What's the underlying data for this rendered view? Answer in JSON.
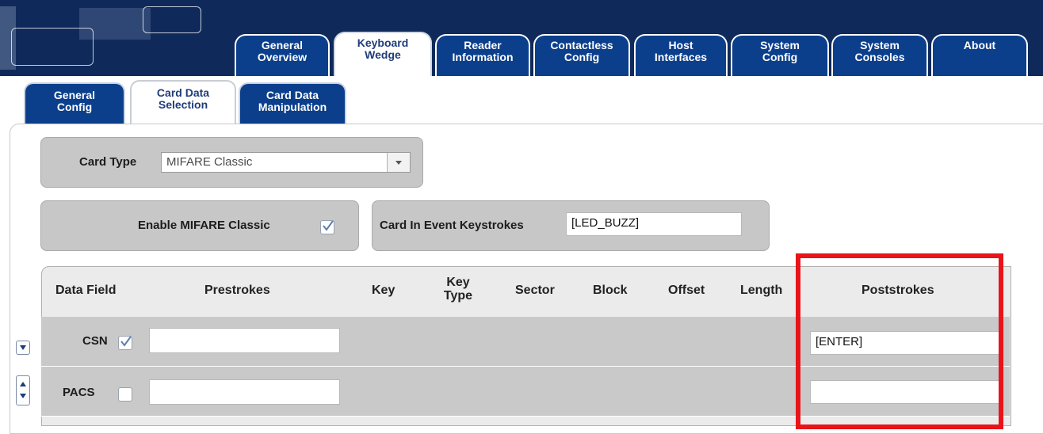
{
  "top_tabs": [
    {
      "label_line1": "General",
      "label_line2": "Overview",
      "active": false
    },
    {
      "label_line1": "Keyboard",
      "label_line2": "Wedge",
      "active": true
    },
    {
      "label_line1": "Reader",
      "label_line2": "Information",
      "active": false
    },
    {
      "label_line1": "Contactless",
      "label_line2": "Config",
      "active": false
    },
    {
      "label_line1": "Host",
      "label_line2": "Interfaces",
      "active": false
    },
    {
      "label_line1": "System",
      "label_line2": "Config",
      "active": false
    },
    {
      "label_line1": "System",
      "label_line2": "Consoles",
      "active": false
    },
    {
      "label_line1": "About",
      "label_line2": "",
      "active": false
    }
  ],
  "sub_tabs": [
    {
      "label_line1": "General",
      "label_line2": "Config",
      "active": false
    },
    {
      "label_line1": "Card Data",
      "label_line2": "Selection",
      "active": true
    },
    {
      "label_line1": "Card Data",
      "label_line2": "Manipulation",
      "active": false
    }
  ],
  "card_type": {
    "label": "Card Type",
    "value": "MIFARE Classic"
  },
  "enable": {
    "label": "Enable MIFARE Classic",
    "checked": true
  },
  "card_in_event": {
    "label": "Card In Event Keystrokes",
    "value": "[LED_BUZZ]"
  },
  "table": {
    "headers": {
      "data_field": "Data Field",
      "prestrokes": "Prestrokes",
      "key": "Key",
      "key_type_line1": "Key",
      "key_type_line2": "Type",
      "sector": "Sector",
      "block": "Block",
      "offset": "Offset",
      "length": "Length",
      "poststrokes": "Poststrokes"
    },
    "rows": [
      {
        "field": "CSN",
        "checked": true,
        "prestrokes": "",
        "poststrokes": "[ENTER]"
      },
      {
        "field": "PACS",
        "checked": false,
        "prestrokes": "",
        "poststrokes": ""
      }
    ]
  },
  "colors": {
    "header_bg": "#0f2a5a",
    "tab_blue": "#0b3f8c",
    "highlight_red": "#e8141a",
    "panel_gray": "#c7c7c7"
  }
}
